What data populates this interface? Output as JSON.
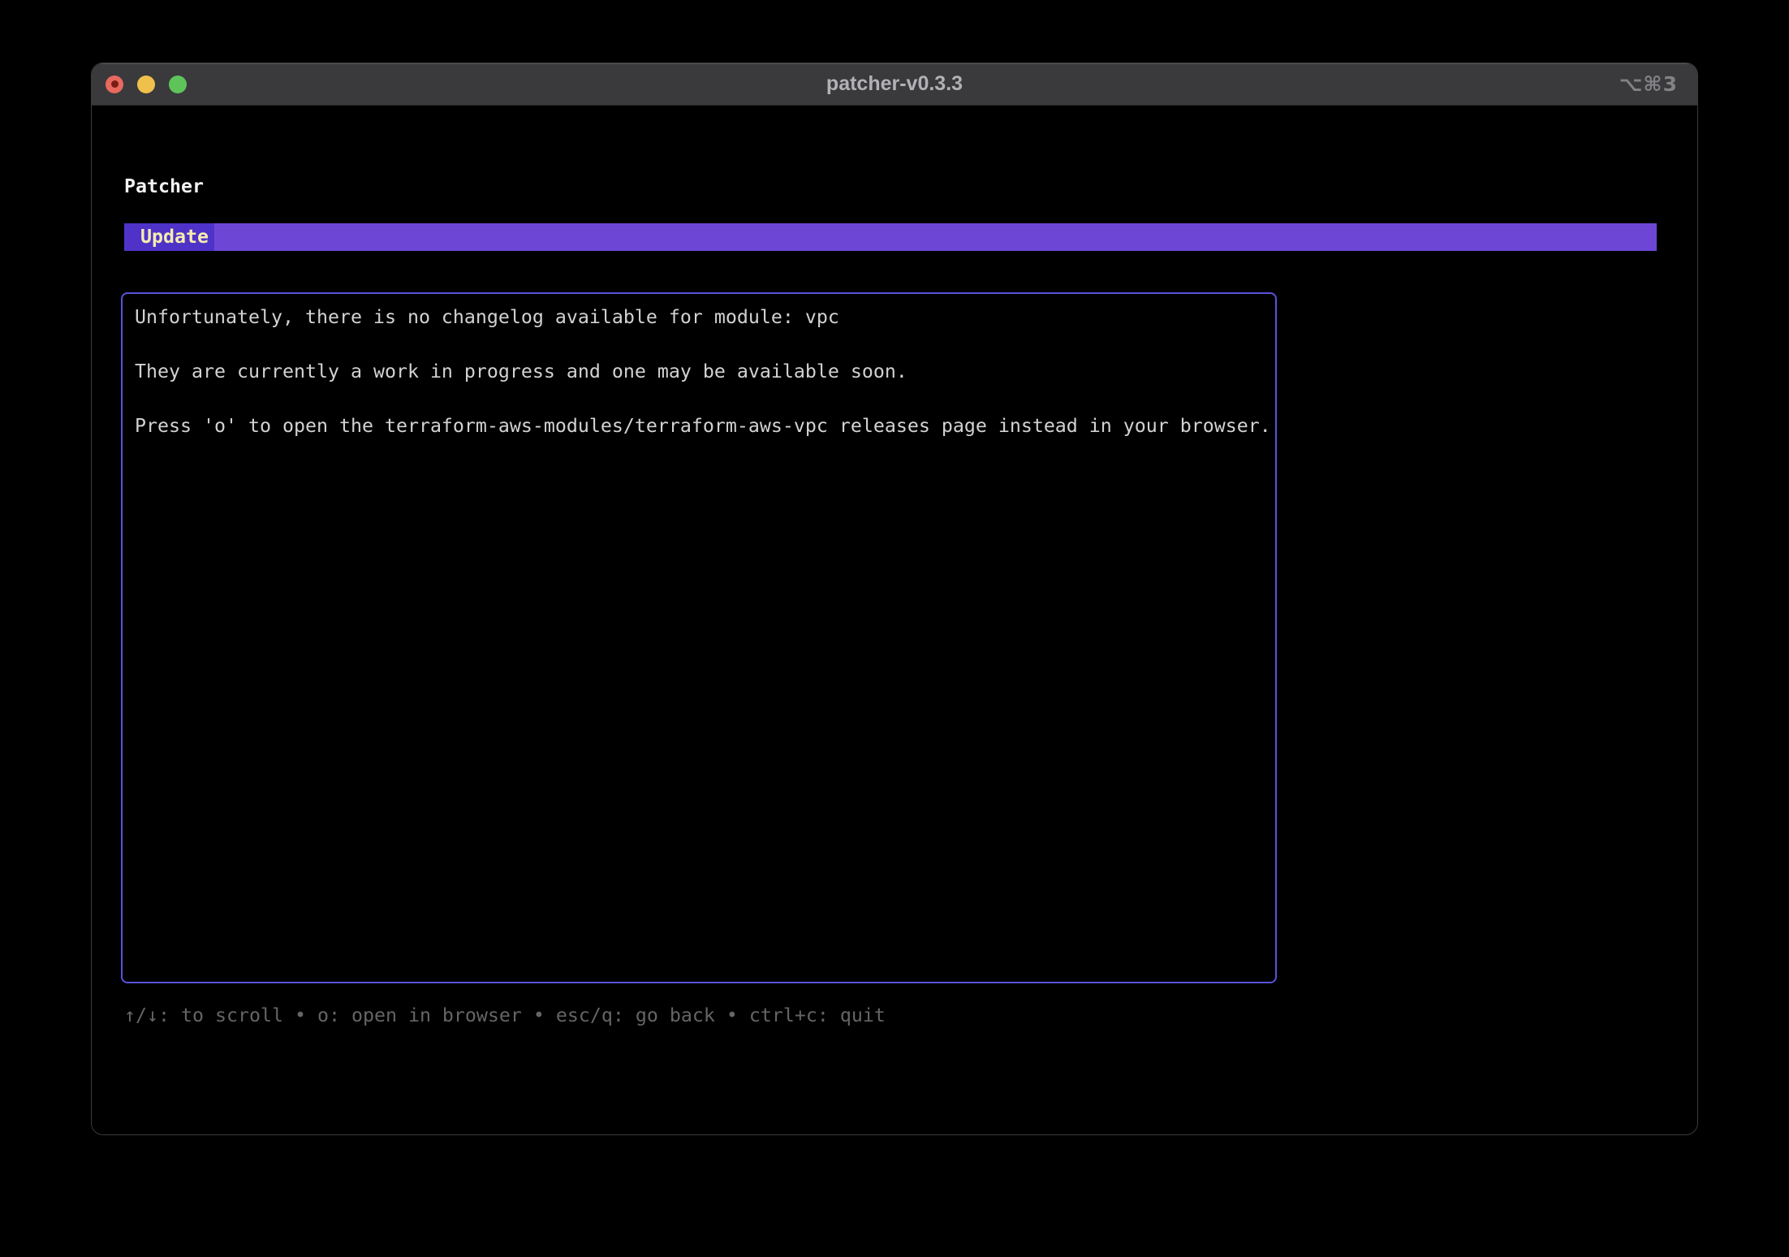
{
  "window": {
    "title": "patcher-v0.3.3",
    "shortcut_hint": "⌥⌘3"
  },
  "app": {
    "heading": "Patcher",
    "tabs": [
      {
        "label": "Update",
        "active": true
      }
    ],
    "changelog": {
      "lines": [
        "Unfortunately, there is no changelog available for module: vpc",
        "They are currently a work in progress and one may be available soon.",
        "Press 'o' to open the terraform-aws-modules/terraform-aws-vpc releases page instead in your browser."
      ]
    },
    "help_bar": {
      "text": "↑/↓: to scroll • o: open in browser • esc/q: go back • ctrl+c: quit"
    }
  },
  "colors": {
    "window_bg": "#000000",
    "titlebar_bg": "#3a3a3c",
    "titlebar_title": "#b2b2b6",
    "titlebar_hint": "#828286",
    "traffic_red": "#e8695f",
    "traffic_red_dot": "#7a1d15",
    "traffic_yellow": "#f0c04d",
    "traffic_green": "#5ec45a",
    "heading_text": "#f2f2f2",
    "tab_active_bg": "#4f33c8",
    "tab_bar_bg": "#6e46d6",
    "tab_text": "#f5ecb0",
    "viewport_border": "#5a52da",
    "body_text": "#d2d2d2",
    "help_text": "#656565"
  }
}
